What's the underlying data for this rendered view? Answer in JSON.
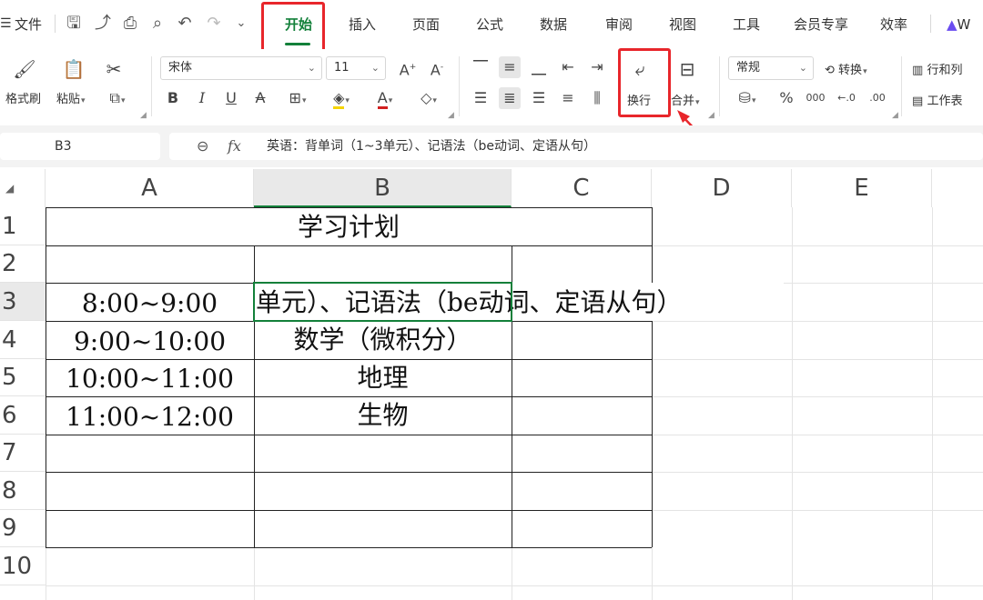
{
  "app": {
    "file_menu": "文件"
  },
  "tabs": [
    {
      "label": "开始",
      "active": true
    },
    {
      "label": "插入"
    },
    {
      "label": "页面"
    },
    {
      "label": "公式"
    },
    {
      "label": "数据"
    },
    {
      "label": "审阅"
    },
    {
      "label": "视图"
    },
    {
      "label": "工具"
    },
    {
      "label": "会员专享"
    },
    {
      "label": "效率"
    },
    {
      "label": "W"
    }
  ],
  "ribbon": {
    "format_painter": "格式刷",
    "paste": "粘贴",
    "font_name": "宋体",
    "font_size": "11",
    "wrap_text": "换行",
    "merge": "合并",
    "number_format": "常规",
    "convert": "转换",
    "rows_cols": "行和列",
    "worksheet": "工作表",
    "bold": "B",
    "italic": "I",
    "underline": "U",
    "strike": "A",
    "font_color": "A",
    "percent": "%",
    "thousands": "000"
  },
  "formula_bar": {
    "cell_ref": "B3",
    "fx": "fx",
    "content": "英语：背单词（1~3单元）、记语法（be动词、定语从句）"
  },
  "sheet": {
    "columns": [
      "A",
      "B",
      "C",
      "D",
      "E"
    ],
    "rows": [
      "1",
      "2",
      "3",
      "4",
      "5",
      "6",
      "7",
      "8",
      "9",
      "10"
    ],
    "selected_cell": "B3",
    "title": "学习计划",
    "schedule": [
      {
        "time": "8:00~9:00",
        "subject": "单元）、记语法（be动词、定语从句）"
      },
      {
        "time": "9:00~10:00",
        "subject": "数学（微积分）"
      },
      {
        "time": "10:00~11:00",
        "subject": "地理"
      },
      {
        "time": "11:00~12:00",
        "subject": "生物"
      }
    ]
  },
  "colors": {
    "accent": "#13803a",
    "highlight": "#e8262b"
  }
}
